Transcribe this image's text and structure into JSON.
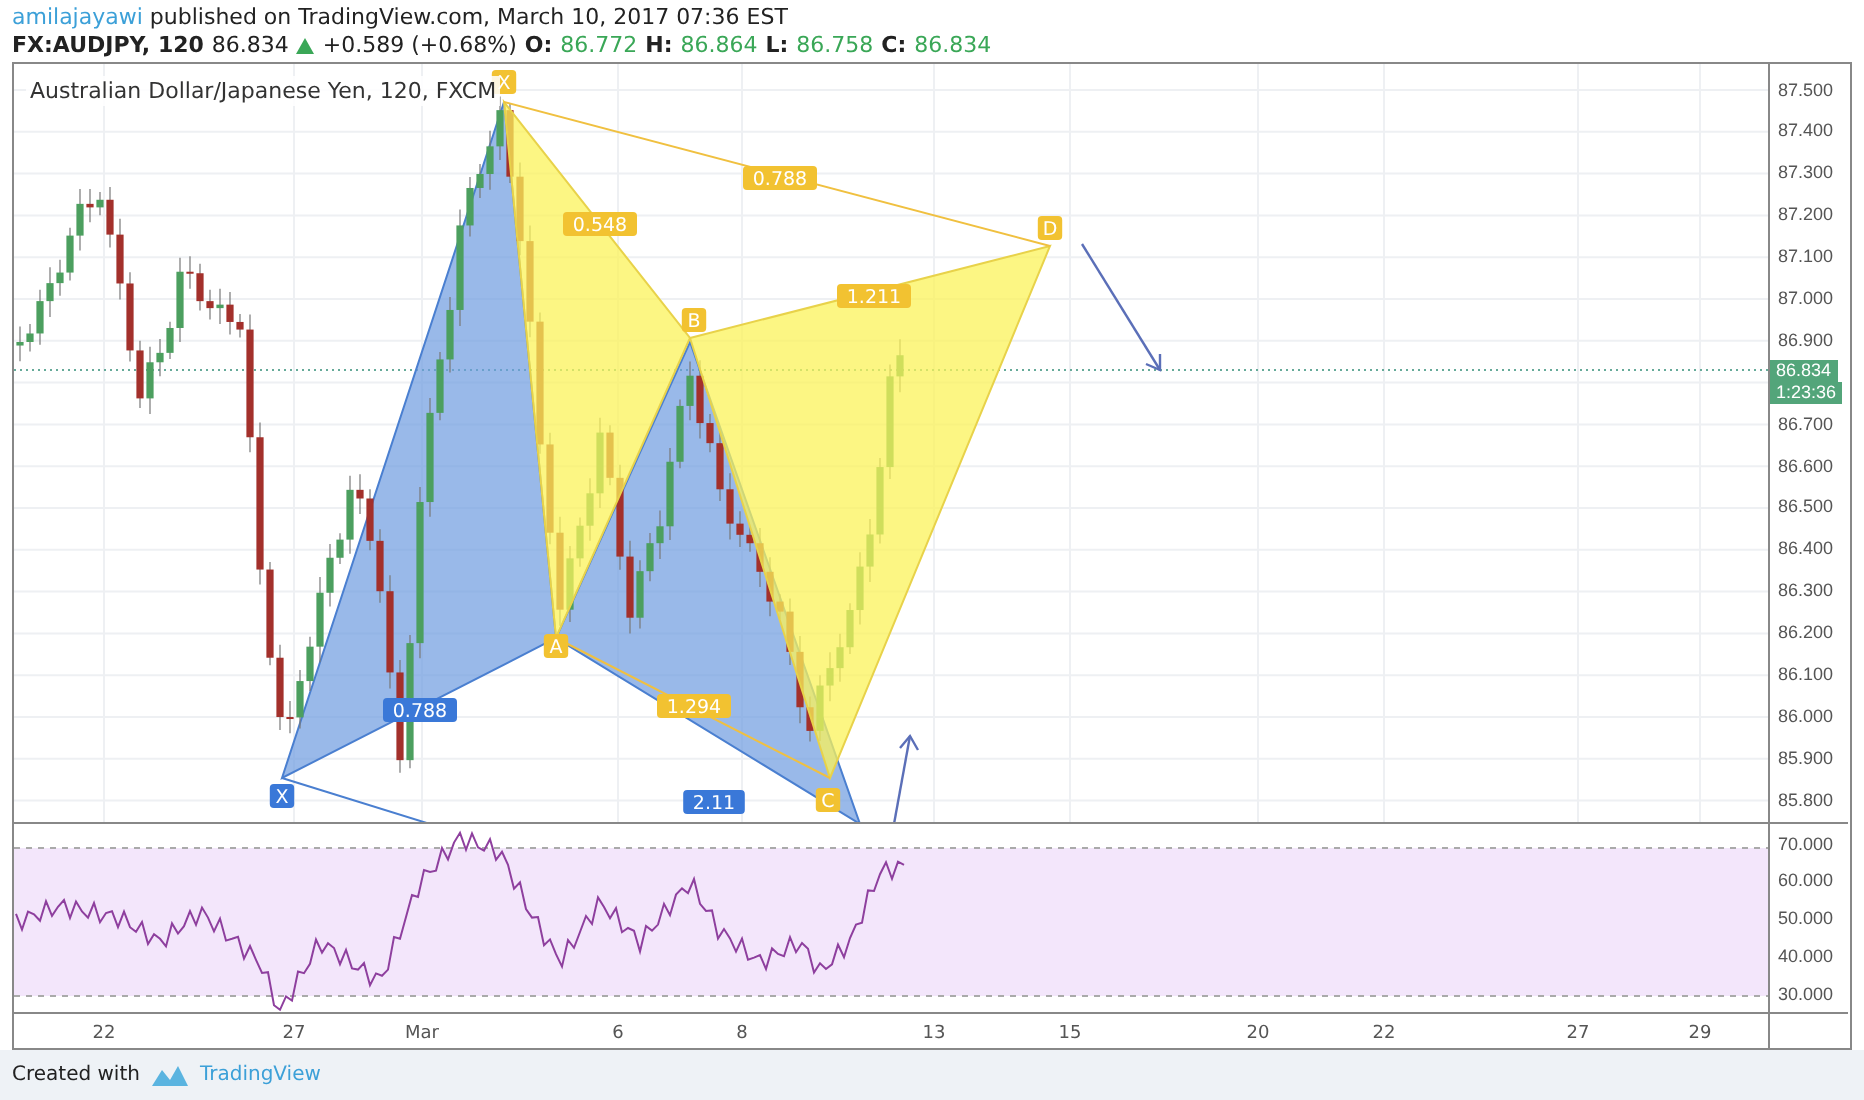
{
  "header": {
    "author": "amilajayawi",
    "published": "published on TradingView.com, March 10, 2017 07:36 EST"
  },
  "quote": {
    "symbol": "FX:AUDJPY, 120",
    "last": "86.834",
    "change": "+0.589 (+0.68%)",
    "ohlc": [
      {
        "label": "O:",
        "value": "86.772"
      },
      {
        "label": "H:",
        "value": "86.864"
      },
      {
        "label": "L:",
        "value": "86.758"
      },
      {
        "label": "C:",
        "value": "86.834"
      }
    ]
  },
  "chart": {
    "legend": "Australian Dollar/Japanese Yen, 120, FXCM",
    "pattern_labels": [
      {
        "text": "X",
        "color": "#f2c231"
      },
      {
        "text": "0.788",
        "color": "#f2c231"
      },
      {
        "text": "0.548",
        "color": "#f2c231"
      },
      {
        "text": "B",
        "color": "#f2c231"
      },
      {
        "text": "1.211",
        "color": "#f2c231"
      },
      {
        "text": "D",
        "color": "#f2c231"
      },
      {
        "text": "A",
        "color": "#f2c231"
      },
      {
        "text": "0.788",
        "color": "#3a78d8"
      },
      {
        "text": "1.294",
        "color": "#f2c231"
      },
      {
        "text": "X",
        "color": "#3a78d8"
      },
      {
        "text": "2.11",
        "color": "#3a78d8"
      },
      {
        "text": "C",
        "color": "#f2c231"
      }
    ],
    "price_axis": [
      "87.500",
      "87.400",
      "87.300",
      "87.200",
      "87.100",
      "87.000",
      "86.900",
      "86.700",
      "86.600",
      "86.500",
      "86.400",
      "86.300",
      "86.200",
      "86.100",
      "86.000",
      "85.900",
      "85.800"
    ],
    "price_tag": "86.834",
    "countdown": "1:23:36",
    "rsi_axis": [
      "70.000",
      "60.000",
      "50.000",
      "40.000",
      "30.000"
    ],
    "time_axis": [
      "22",
      "27",
      "Mar",
      "6",
      "8",
      "13",
      "15",
      "20",
      "22",
      "27",
      "29"
    ]
  },
  "footer": {
    "created_with": "Created with",
    "brand": "TradingView"
  }
}
